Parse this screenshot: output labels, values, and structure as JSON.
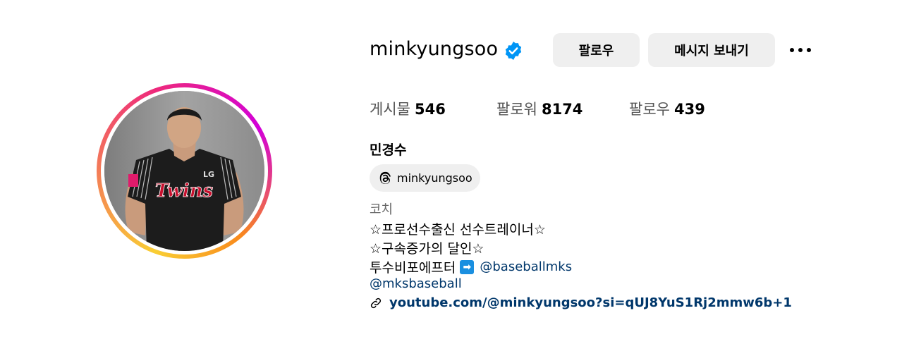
{
  "profile": {
    "username": "minkyungsoo",
    "verified_icon": "verified-badge-icon",
    "follow_label": "팔로우",
    "message_label": "메시지 보내기",
    "more_icon": "more-options-icon"
  },
  "stats": {
    "posts_label": "게시물",
    "posts_value": "546",
    "followers_label": "팔로워",
    "followers_value": "8174",
    "following_label": "팔로우",
    "following_value": "439"
  },
  "bio": {
    "full_name": "민경수",
    "threads_handle": "minkyungsoo",
    "category": "코치",
    "line1": "☆프로선수출신 선수트레이너☆",
    "line2": "☆구속증가의 달인☆",
    "line3_text": "투수비포에프터",
    "line3_emoji": "➡",
    "line3_mention": "@baseballmks",
    "mention2": "@mksbaseball",
    "link_url": "youtube.com/@minkyungsoo?si=qUJ8YuS1Rj2mmw6b+1"
  },
  "colors": {
    "link": "#00376b",
    "verified": "#0095f6",
    "button_bg": "#efefef"
  }
}
